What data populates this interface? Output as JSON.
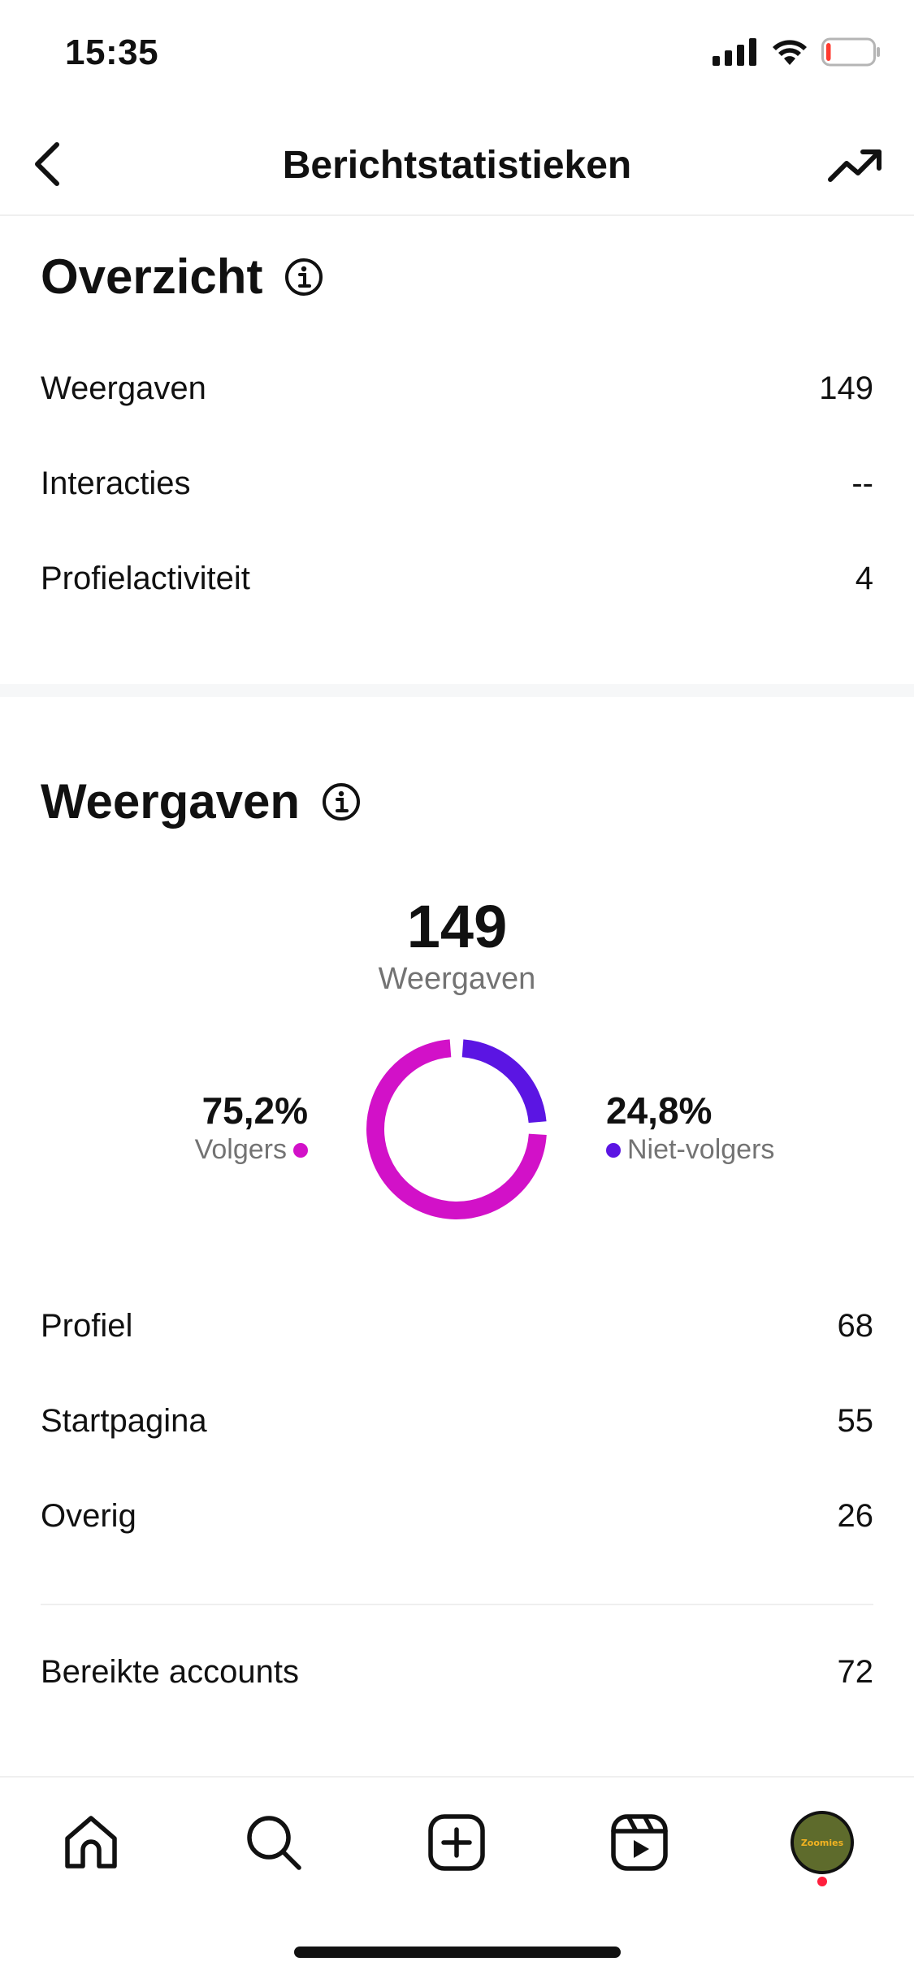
{
  "status_bar": {
    "time": "15:35",
    "battery_level": 0.1
  },
  "header": {
    "title": "Berichtstatistieken"
  },
  "overview": {
    "title": "Overzicht",
    "rows": [
      {
        "label": "Weergaven",
        "value": "149"
      },
      {
        "label": "Interacties",
        "value": "--"
      },
      {
        "label": "Profielactiviteit",
        "value": "4"
      }
    ]
  },
  "views": {
    "title": "Weergaven",
    "total_value": "149",
    "total_label": "Weergaven",
    "segments": [
      {
        "pct": "75,2%",
        "label": "Volgers",
        "color": "#d211c8",
        "fraction": 0.752
      },
      {
        "pct": "24,8%",
        "label": "Niet-volgers",
        "color": "#5b15e3",
        "fraction": 0.248
      }
    ],
    "sources": [
      {
        "label": "Profiel",
        "value": "68"
      },
      {
        "label": "Startpagina",
        "value": "55"
      },
      {
        "label": "Overig",
        "value": "26"
      }
    ],
    "reached": {
      "label": "Bereikte accounts",
      "value": "72"
    }
  },
  "tab_bar": {
    "items": [
      "home-icon",
      "search-icon",
      "create-icon",
      "reels-icon",
      "profile-avatar"
    ],
    "avatar_text": "Zoomies"
  },
  "colors": {
    "followers": "#d211c8",
    "non_followers": "#5b15e3",
    "notification": "#ff1f3d"
  }
}
